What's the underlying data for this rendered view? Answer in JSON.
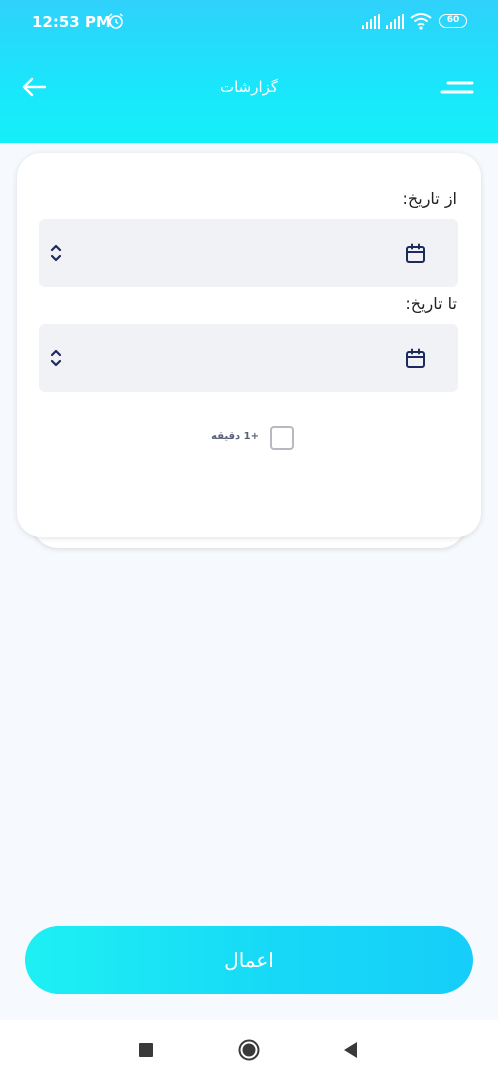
{
  "status_bar": {
    "time": "12:53 PM",
    "battery": "60"
  },
  "header": {
    "title": "گزارشات",
    "back_icon": "arrow-left-icon",
    "menu_icon": "menu-icon"
  },
  "form": {
    "from_label": "از تاریخ:",
    "to_label": "تا تاریخ:",
    "from_value": "",
    "to_value": "",
    "checkbox_label": "+1 دقیقه",
    "checkbox_checked": false
  },
  "actions": {
    "apply_label": "اعمال"
  },
  "colors": {
    "header_gradient_start": "#2fd1fb",
    "header_gradient_end": "#14f0fa",
    "accent": "#17d9f7",
    "icon_dark": "#1d2a5c"
  }
}
